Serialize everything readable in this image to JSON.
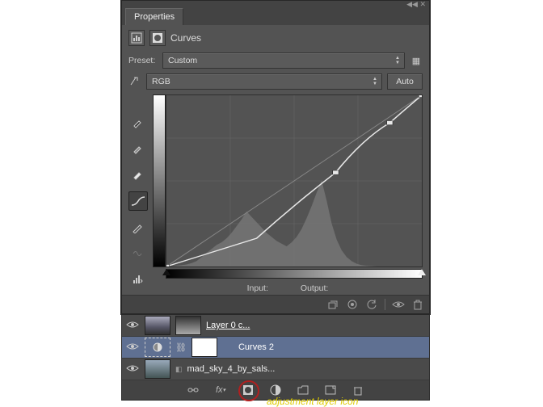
{
  "properties_panel": {
    "tab_label": "Properties",
    "title": "Curves",
    "preset_label": "Preset:",
    "preset_value": "Custom",
    "channel_value": "RGB",
    "auto_label": "Auto",
    "input_label": "Input:",
    "output_label": "Output:"
  },
  "layers": {
    "items": [
      {
        "name": "Layer 0 c...",
        "selected": false,
        "underline": true
      },
      {
        "name": "Curves 2",
        "selected": true,
        "underline": false
      },
      {
        "name": "mad_sky_4_by_sals...",
        "selected": false,
        "underline": false
      }
    ]
  },
  "annotation": {
    "label": "adjustment layer icon"
  },
  "chart_data": {
    "type": "line",
    "title": "Curves",
    "xlabel": "Input",
    "ylabel": "Output",
    "xlim": [
      0,
      255
    ],
    "ylim": [
      0,
      255
    ],
    "series": [
      {
        "name": "baseline",
        "x": [
          0,
          255
        ],
        "y": [
          0,
          255
        ]
      },
      {
        "name": "curve",
        "x": [
          0,
          90,
          169,
          223,
          255
        ],
        "y": [
          0,
          42,
          140,
          214,
          255
        ]
      }
    ],
    "histogram_approx": [
      0,
      0,
      0,
      1,
      2,
      3,
      5,
      8,
      14,
      20,
      26,
      32,
      36,
      42,
      50,
      60,
      70,
      82,
      74,
      66,
      58,
      50,
      44,
      38,
      34,
      30,
      36,
      44,
      56,
      72,
      90,
      110,
      128,
      98,
      64,
      40,
      24,
      14,
      8,
      4,
      2,
      1,
      0,
      0,
      0,
      0,
      0,
      0,
      0,
      0
    ]
  }
}
